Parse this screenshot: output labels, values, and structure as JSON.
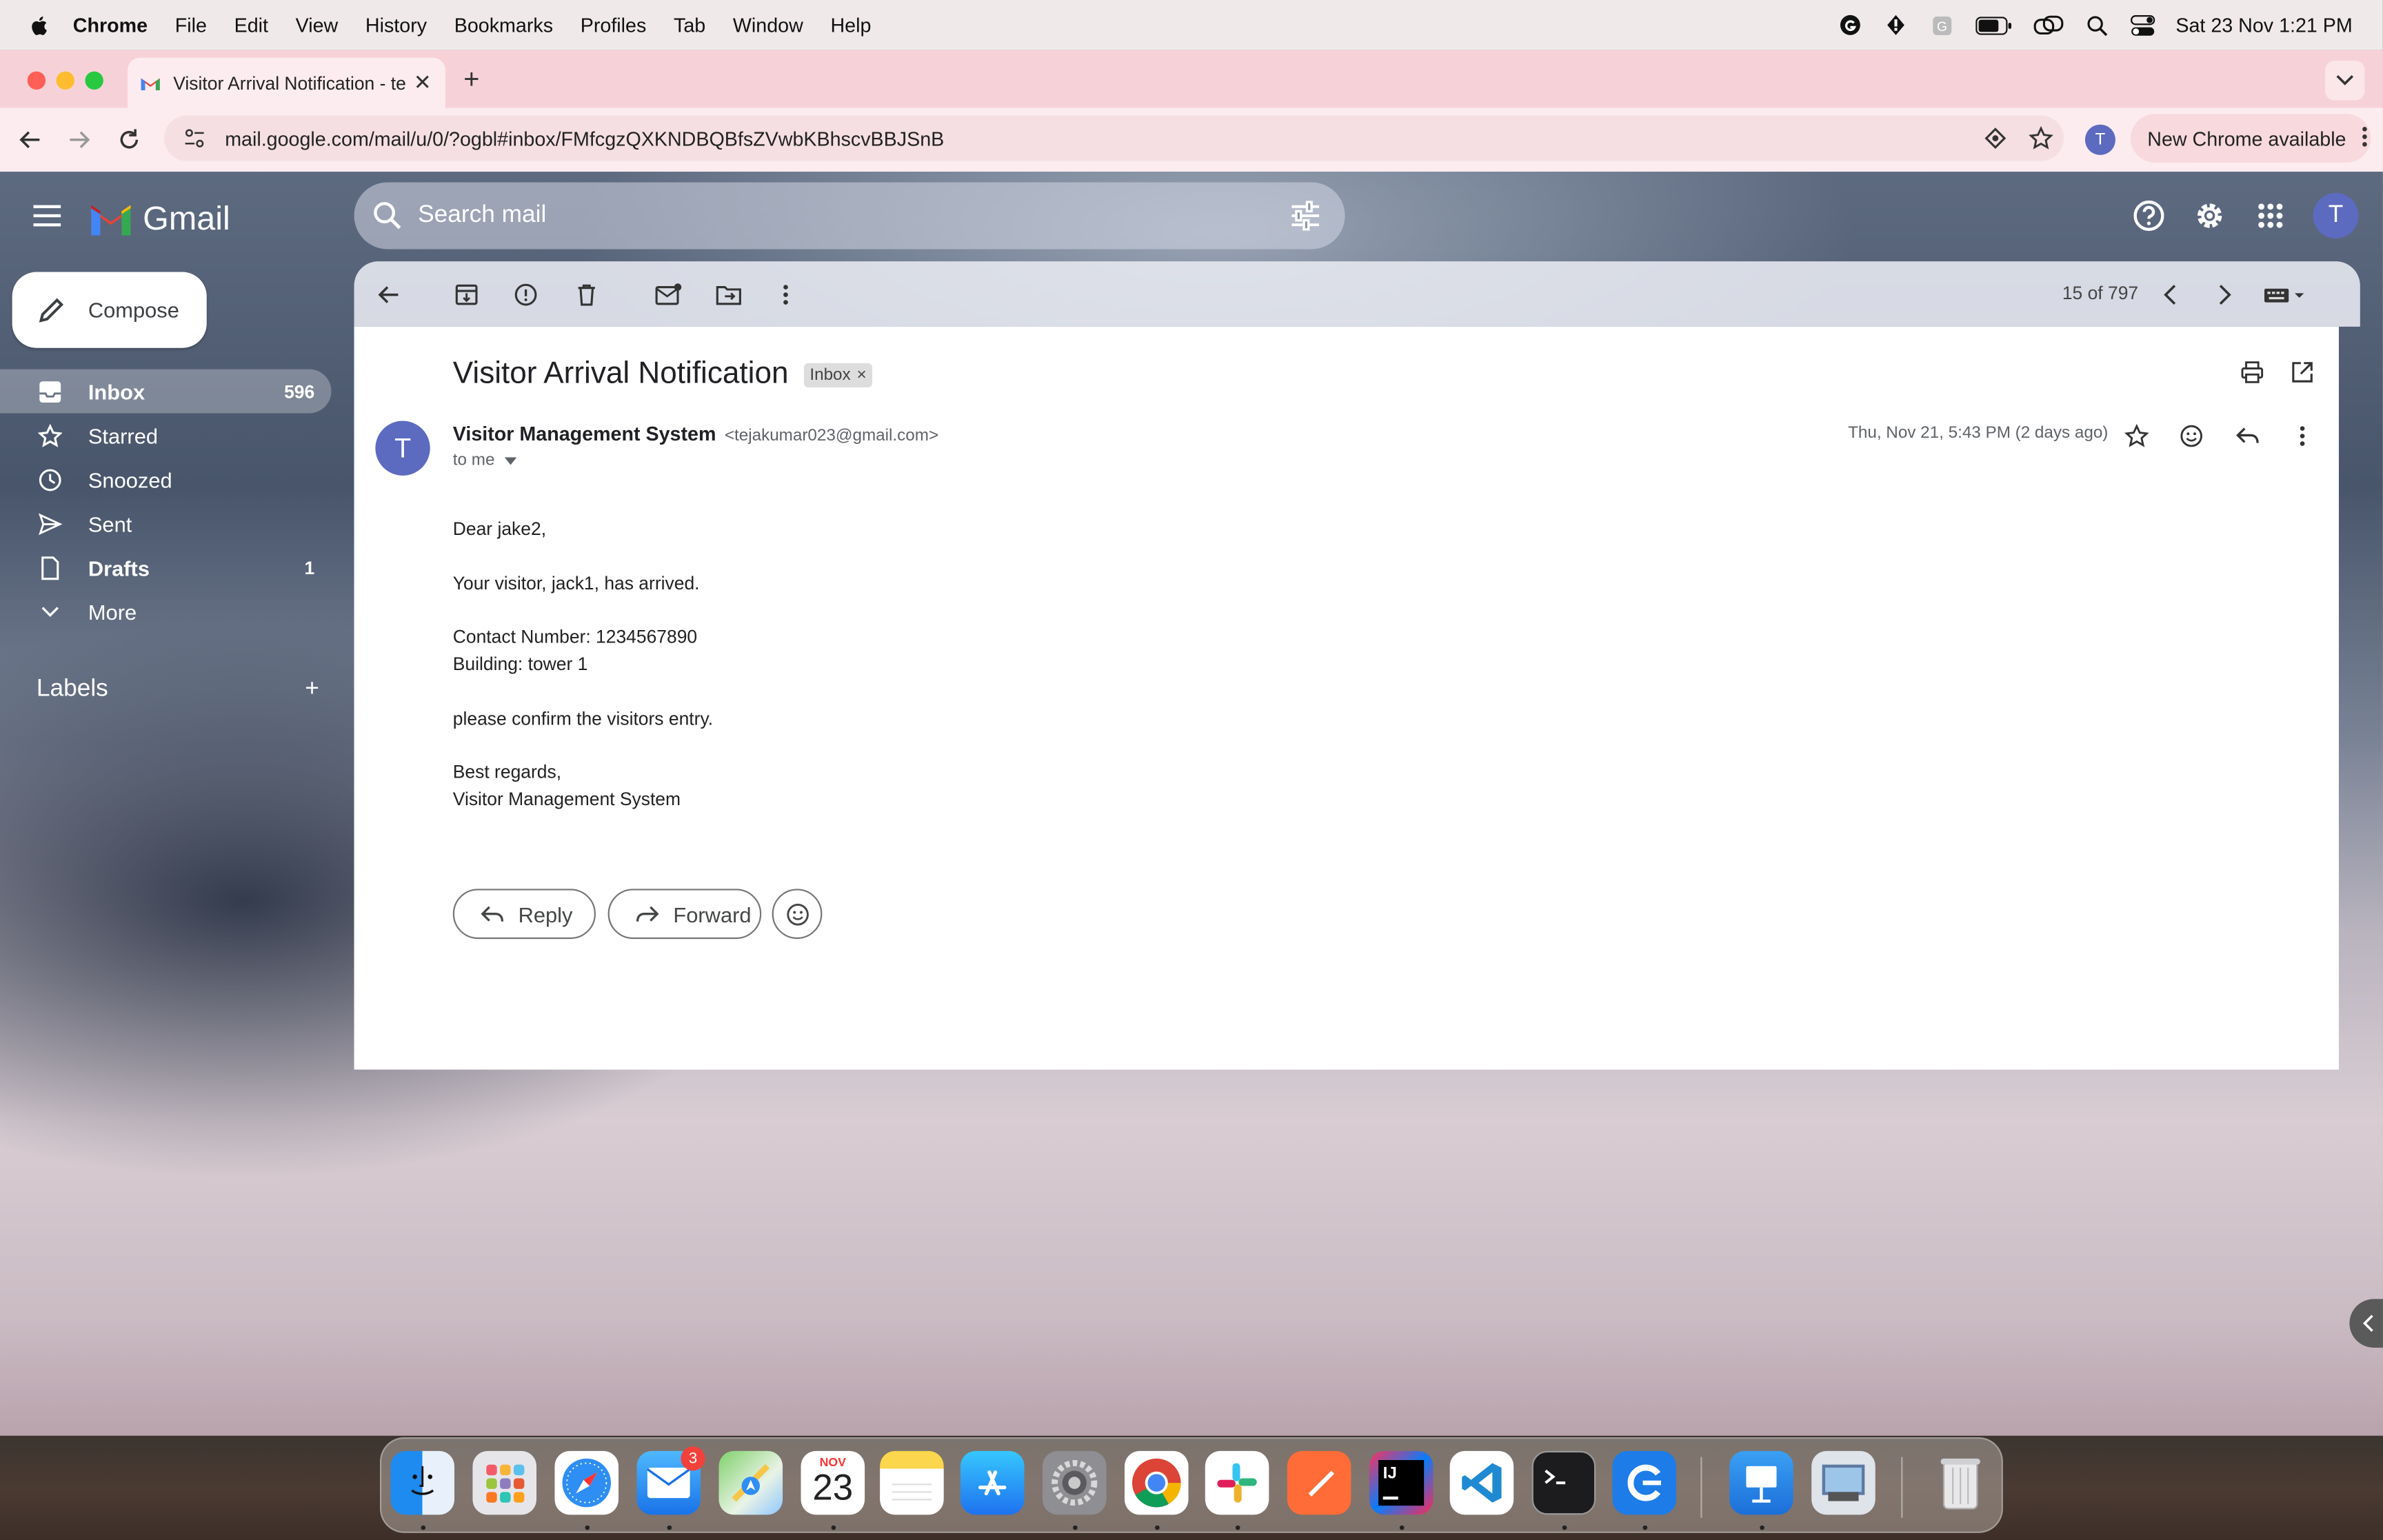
{
  "menubar": {
    "app": "Chrome",
    "items": [
      "File",
      "Edit",
      "View",
      "History",
      "Bookmarks",
      "Profiles",
      "Tab",
      "Window",
      "Help"
    ],
    "datetime": "Sat 23 Nov  1:21 PM"
  },
  "browser": {
    "tab_title": "Visitor Arrival Notification - te",
    "url": "mail.google.com/mail/u/0/?ogbl#inbox/FMfcgzQXKNDBQBfsZVwbKBhscvBBJSnB",
    "profile_initial": "T",
    "update_label": "New Chrome available"
  },
  "gmail": {
    "brand": "Gmail",
    "search_placeholder": "Search mail",
    "avatar_initial": "T",
    "compose_label": "Compose",
    "nav": [
      {
        "label": "Inbox",
        "count": "596",
        "icon": "inbox-icon"
      },
      {
        "label": "Starred",
        "count": "",
        "icon": "star-icon"
      },
      {
        "label": "Snoozed",
        "count": "",
        "icon": "clock-icon"
      },
      {
        "label": "Sent",
        "count": "",
        "icon": "send-icon"
      },
      {
        "label": "Drafts",
        "count": "1",
        "icon": "draft-icon"
      },
      {
        "label": "More",
        "count": "",
        "icon": "chevron-down-icon"
      }
    ],
    "labels_heading": "Labels",
    "labels_add": "+",
    "pager": "15 of 797"
  },
  "message": {
    "subject": "Visitor Arrival Notification",
    "chip": "Inbox",
    "chip_close": "×",
    "sender_initial": "T",
    "sender_name": "Visitor Management System",
    "sender_email": "<tejakumar023@gmail.com>",
    "to": "to me",
    "date": "Thu, Nov 21, 5:43 PM (2 days ago)",
    "body": {
      "greeting": "Dear jake2,",
      "line1": "Your visitor, jack1, has arrived.",
      "contact": "Contact Number: 1234567890",
      "building": "Building: tower 1",
      "confirm": "please confirm the visitors entry.",
      "closing": "Best regards,",
      "signature": "Visitor Management System"
    },
    "reply_label": "Reply",
    "forward_label": "Forward"
  },
  "dock": {
    "calendar_month": "NOV",
    "calendar_day": "23",
    "mail_badge": "3"
  },
  "colors": {
    "accent": "#5c6bc0",
    "chrome_tabstrip": "#f6d2d8"
  }
}
